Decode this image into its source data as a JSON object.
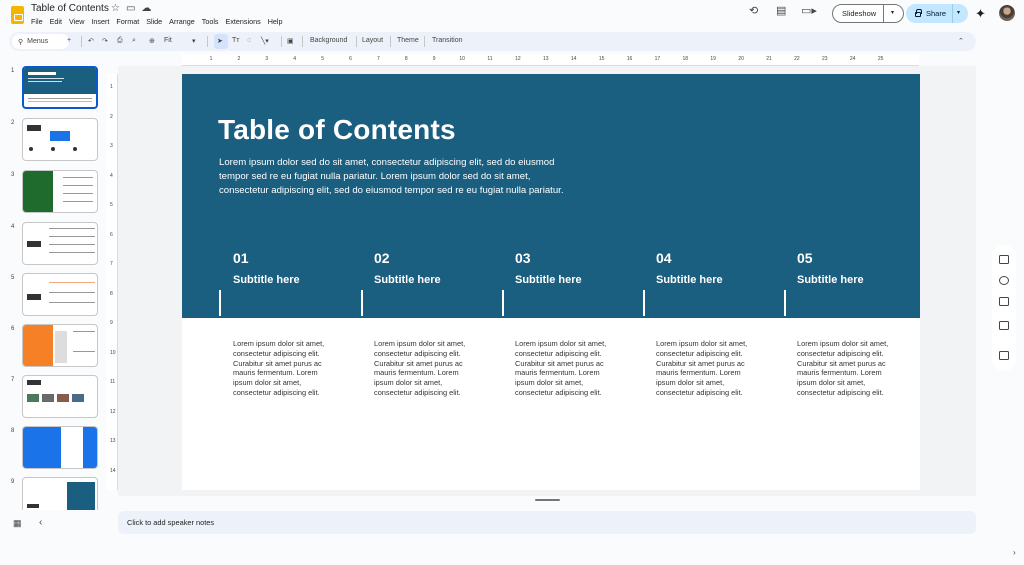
{
  "app": {
    "doc_title": "Table of Contents",
    "menu": [
      "File",
      "Edit",
      "View",
      "Insert",
      "Format",
      "Slide",
      "Arrange",
      "Tools",
      "Extensions",
      "Help"
    ],
    "slideshow_label": "Slideshow",
    "share_label": "Share"
  },
  "toolbar": {
    "search_label": "Menus",
    "zoom_label": "Fit",
    "background_label": "Background",
    "layout_label": "Layout",
    "theme_label": "Theme",
    "transition_label": "Transition"
  },
  "ruler": {
    "horizontal": [
      "1",
      "2",
      "3",
      "4",
      "5",
      "6",
      "7",
      "8",
      "9",
      "10",
      "11",
      "12",
      "13",
      "14",
      "15",
      "16",
      "17",
      "18",
      "19",
      "20",
      "21",
      "22",
      "23",
      "24",
      "25"
    ],
    "vertical": [
      "1",
      "2",
      "3",
      "4",
      "5",
      "6",
      "7",
      "8",
      "9",
      "10",
      "11",
      "12",
      "13",
      "14"
    ]
  },
  "filmstrip": {
    "numbers": [
      "1",
      "2",
      "3",
      "4",
      "5",
      "6",
      "7",
      "8",
      "9"
    ],
    "selected": 1
  },
  "slide": {
    "title": "Table of Contents",
    "description": "Lorem ipsum dolor sed do sit amet, consectetur adipiscing elit, sed do eiusmod tempor sed re eu fugiat nulla pariatur. Lorem ipsum dolor sed do sit amet, consectetur adipiscing elit, sed do eiusmod tempor sed re eu fugiat nulla pariatur.",
    "items": [
      {
        "num": "01",
        "subtitle": "Subtitle here",
        "body": "Lorem ipsum dolor sit amet, consectetur adipiscing elit. Curabitur sit amet purus ac mauris fermentum. Lorem ipsum dolor sit amet, consectetur adipiscing elit."
      },
      {
        "num": "02",
        "subtitle": "Subtitle here",
        "body": "Lorem ipsum dolor sit amet, consectetur adipiscing elit. Curabitur sit amet purus ac mauris fermentum. Lorem ipsum dolor sit amet, consectetur adipiscing elit."
      },
      {
        "num": "03",
        "subtitle": "Subtitle here",
        "body": "Lorem ipsum dolor sit amet, consectetur adipiscing elit. Curabitur sit amet purus ac mauris fermentum. Lorem ipsum dolor sit amet, consectetur adipiscing elit."
      },
      {
        "num": "04",
        "subtitle": "Subtitle here",
        "body": "Lorem ipsum dolor sit amet, consectetur adipiscing elit. Curabitur sit amet purus ac mauris fermentum. Lorem ipsum dolor sit amet, consectetur adipiscing elit."
      },
      {
        "num": "05",
        "subtitle": "Subtitle here",
        "body": "Lorem ipsum dolor sit amet, consectetur adipiscing elit. Curabitur sit amet purus ac mauris fermentum. Lorem ipsum dolor sit amet, consectetur adipiscing elit."
      }
    ]
  },
  "notes": {
    "placeholder": "Click to add speaker notes"
  },
  "colors": {
    "slide_primary": "#1a5e80",
    "accent": "#0b57d0",
    "share_bg": "#c2e7ff",
    "toolbar_bg": "#edf2fa"
  }
}
